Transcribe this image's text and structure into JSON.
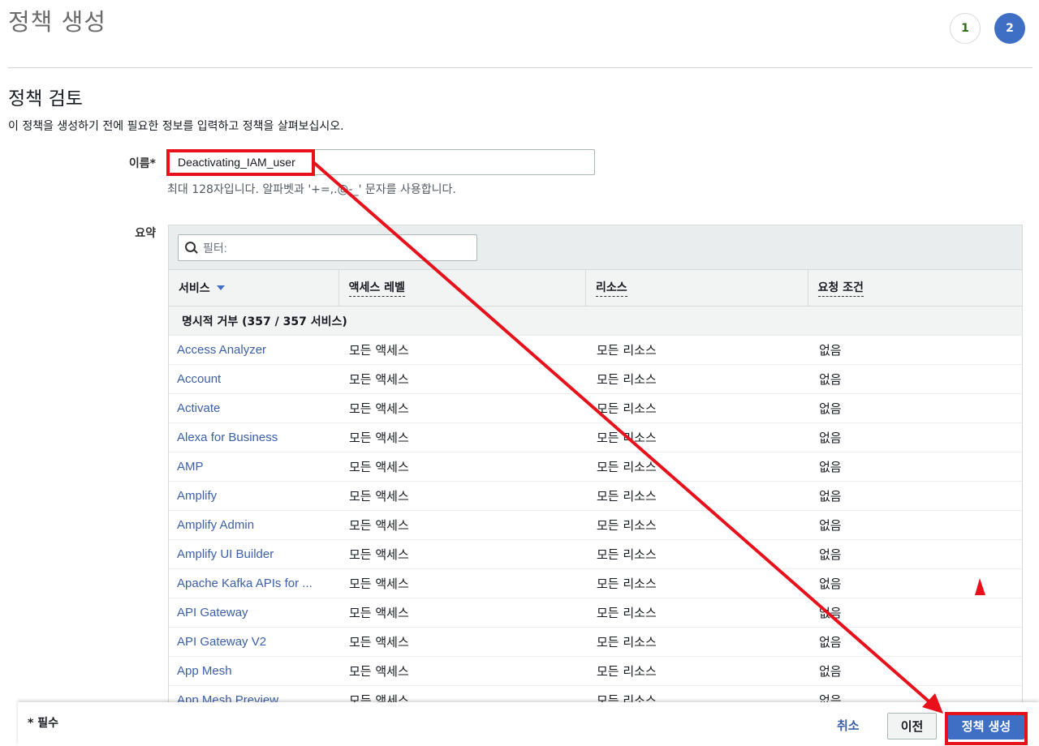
{
  "header": {
    "title": "정책 생성",
    "steps": [
      "1",
      "2"
    ],
    "active_step": 2
  },
  "section": {
    "title": "정책 검토",
    "description": "이 정책을 생성하기 전에 필요한 정보를 입력하고 정책을 살펴보십시오."
  },
  "name_field": {
    "label": "이름*",
    "value": "Deactivating_IAM_user",
    "hint": "최대 128자입니다. 알파벳과 '+=,.@-_' 문자를 사용합니다."
  },
  "summary": {
    "label": "요약",
    "filter_placeholder": "필터:",
    "columns": [
      "서비스",
      "액세스 레벨",
      "리소스",
      "요청 조건"
    ],
    "group_label": "명시적 거부 (357 / 357 서비스)",
    "rows": [
      {
        "service": "Access Analyzer",
        "access": "모든 액세스",
        "resource": "모든 리소스",
        "condition": "없음"
      },
      {
        "service": "Account",
        "access": "모든 액세스",
        "resource": "모든 리소스",
        "condition": "없음"
      },
      {
        "service": "Activate",
        "access": "모든 액세스",
        "resource": "모든 리소스",
        "condition": "없음"
      },
      {
        "service": "Alexa for Business",
        "access": "모든 액세스",
        "resource": "모든 리소스",
        "condition": "없음"
      },
      {
        "service": "AMP",
        "access": "모든 액세스",
        "resource": "모든 리소스",
        "condition": "없음"
      },
      {
        "service": "Amplify",
        "access": "모든 액세스",
        "resource": "모든 리소스",
        "condition": "없음"
      },
      {
        "service": "Amplify Admin",
        "access": "모든 액세스",
        "resource": "모든 리소스",
        "condition": "없음"
      },
      {
        "service": "Amplify UI Builder",
        "access": "모든 액세스",
        "resource": "모든 리소스",
        "condition": "없음"
      },
      {
        "service": "Apache Kafka APIs for ...",
        "access": "모든 액세스",
        "resource": "모든 리소스",
        "condition": "없음"
      },
      {
        "service": "API Gateway",
        "access": "모든 액세스",
        "resource": "모든 리소스",
        "condition": "없음"
      },
      {
        "service": "API Gateway V2",
        "access": "모든 액세스",
        "resource": "모든 리소스",
        "condition": "없음"
      },
      {
        "service": "App Mesh",
        "access": "모든 액세스",
        "resource": "모든 리소스",
        "condition": "없음"
      },
      {
        "service": "App Mesh Preview",
        "access": "모든 액세스",
        "resource": "모든 리소스",
        "condition": "없음"
      }
    ]
  },
  "footer": {
    "required_note": "* 필수",
    "cancel_label": "취소",
    "previous_label": "이전",
    "create_label": "정책 생성"
  },
  "colors": {
    "accent": "#3f6fc4",
    "link": "#3c5fa8",
    "annotation": "#e8101a"
  }
}
